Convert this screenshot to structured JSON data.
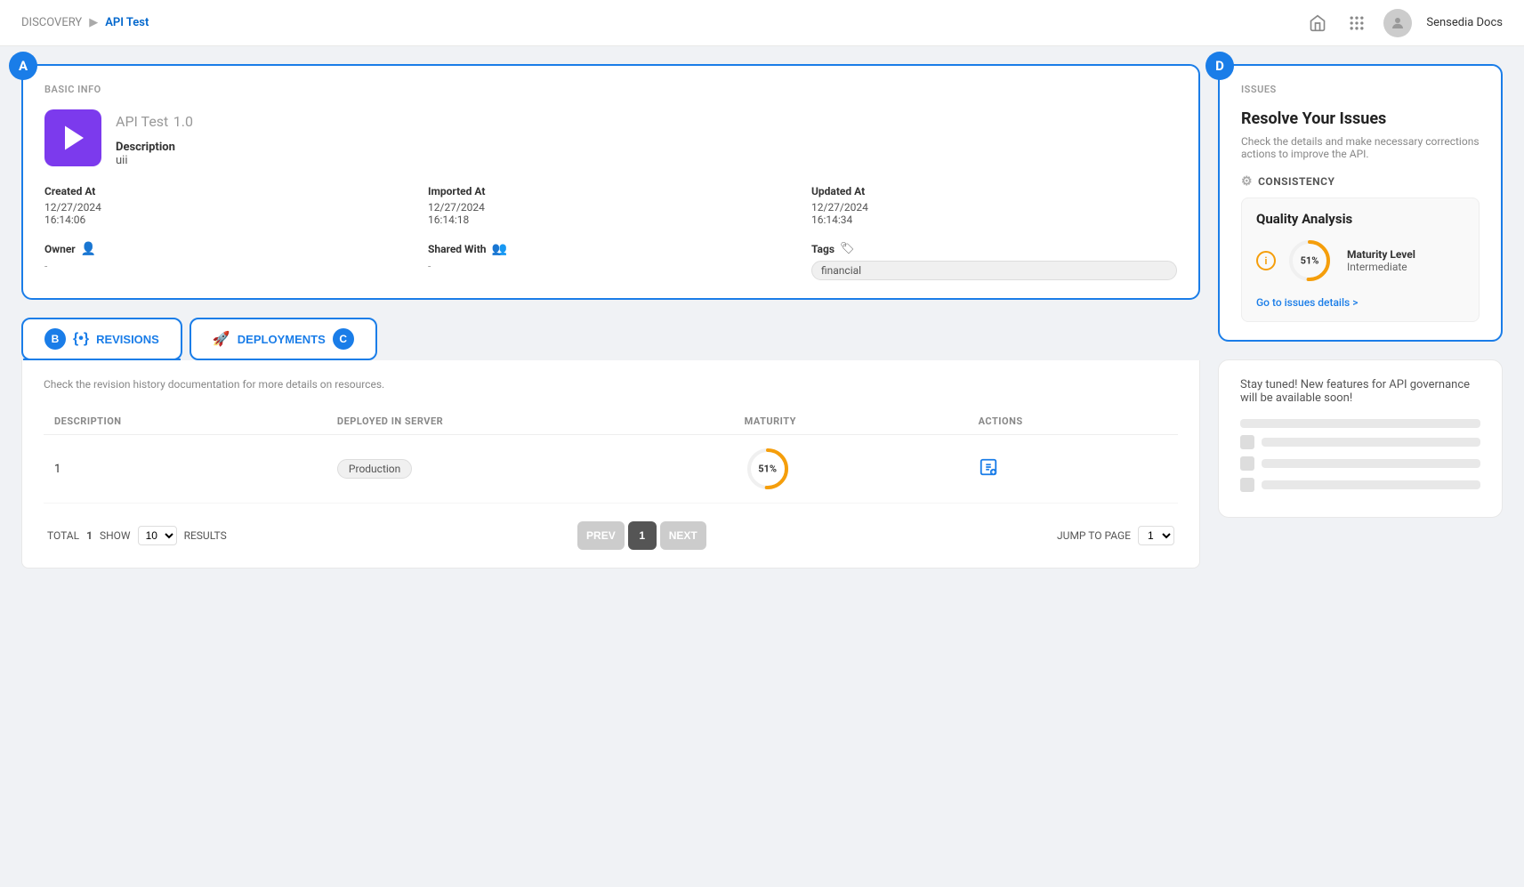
{
  "nav": {
    "breadcrumb_base": "DISCOVERY",
    "breadcrumb_current": "API Test",
    "docs_link": "Sensedia Docs"
  },
  "basic_info": {
    "section_label": "BASIC INFO",
    "badge": "A",
    "api_name": "API Test",
    "api_version": "1.0",
    "description_label": "Description",
    "description_value": "uii",
    "created_at_label": "Created At",
    "created_at_date": "12/27/2024",
    "created_at_time": "16:14:06",
    "imported_at_label": "Imported At",
    "imported_at_date": "12/27/2024",
    "imported_at_time": "16:14:18",
    "updated_at_label": "Updated At",
    "updated_at_date": "12/27/2024",
    "updated_at_time": "16:14:34",
    "owner_label": "Owner",
    "owner_value": "-",
    "shared_with_label": "Shared With",
    "shared_with_value": "-",
    "tags_label": "Tags",
    "tags": [
      "financial"
    ]
  },
  "tabs": {
    "badge_b": "B",
    "badge_c": "C",
    "revisions_label": "REVISIONS",
    "deployments_label": "DEPLOYMENTS",
    "revisions_description": "Check the revision history documentation for more details on resources.",
    "table_headers": [
      "DESCRIPTION",
      "DEPLOYED IN SERVER",
      "MATURITY",
      "ACTIONS"
    ],
    "rows": [
      {
        "description": "1",
        "deployed_in_server": "Production",
        "maturity_percent": 51,
        "maturity_label": "51%"
      }
    ],
    "pagination": {
      "total_label": "TOTAL",
      "total_value": "1",
      "show_label": "SHOW",
      "show_value": "10",
      "results_label": "RESULTS",
      "prev_label": "PREV",
      "next_label": "NEXT",
      "current_page": "1",
      "jump_label": "JUMP TO PAGE",
      "jump_value": "1"
    }
  },
  "issues": {
    "section_label": "ISSUES",
    "badge": "D",
    "title": "Resolve Your Issues",
    "description": "Check the details and make necessary corrections actions to improve the API.",
    "consistency_label": "CONSISTENCY",
    "quality_analysis_title": "Quality Analysis",
    "maturity_percent": 51,
    "maturity_label": "51%",
    "maturity_level_label": "Maturity Level",
    "maturity_level_value": "Intermediate",
    "issues_link": "Go to issues details >"
  },
  "stay_tuned": {
    "text": "Stay tuned! New features for API governance will be available soon!"
  }
}
